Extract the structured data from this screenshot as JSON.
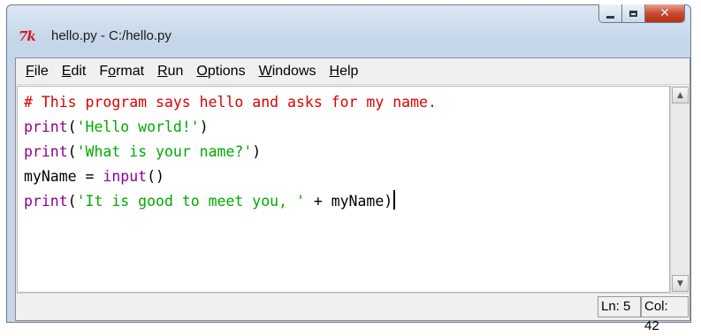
{
  "window": {
    "title": "hello.py - C:/hello.py",
    "app_icon": "7k",
    "controls": [
      "minimize-icon",
      "maximize-icon",
      "close-icon"
    ]
  },
  "menu": {
    "items": [
      {
        "label": "File",
        "mnemonic": "F",
        "rest": "ile"
      },
      {
        "label": "Edit",
        "mnemonic": "E",
        "rest": "dit"
      },
      {
        "label": "Format",
        "pre": "F",
        "mnemonic": "o",
        "rest": "rmat"
      },
      {
        "label": "Run",
        "mnemonic": "R",
        "rest": "un"
      },
      {
        "label": "Options",
        "mnemonic": "O",
        "rest": "ptions"
      },
      {
        "label": "Windows",
        "mnemonic": "W",
        "rest": "indows"
      },
      {
        "label": "Help",
        "mnemonic": "H",
        "rest": "elp"
      }
    ]
  },
  "editor": {
    "lines": [
      [
        {
          "t": "# This program says hello and asks for my name.",
          "c": "comment"
        }
      ],
      [
        {
          "t": "print",
          "c": "builtin"
        },
        {
          "t": "(",
          "c": "plain"
        },
        {
          "t": "'Hello world!'",
          "c": "string"
        },
        {
          "t": ")",
          "c": "plain"
        }
      ],
      [
        {
          "t": "print",
          "c": "builtin"
        },
        {
          "t": "(",
          "c": "plain"
        },
        {
          "t": "'What is your name?'",
          "c": "string"
        },
        {
          "t": ")",
          "c": "plain"
        }
      ],
      [
        {
          "t": "myName = ",
          "c": "plain"
        },
        {
          "t": "input",
          "c": "builtin"
        },
        {
          "t": "()",
          "c": "plain"
        }
      ],
      [
        {
          "t": "print",
          "c": "builtin"
        },
        {
          "t": "(",
          "c": "plain"
        },
        {
          "t": "'It is good to meet you, '",
          "c": "string"
        },
        {
          "t": " + myName)",
          "c": "plain"
        }
      ]
    ],
    "colors": {
      "comment": "#dd0000",
      "builtin": "#900090",
      "string": "#00aa00",
      "plain": "#000000"
    }
  },
  "status": {
    "line": "Ln: 5",
    "col": "Col: 42"
  }
}
